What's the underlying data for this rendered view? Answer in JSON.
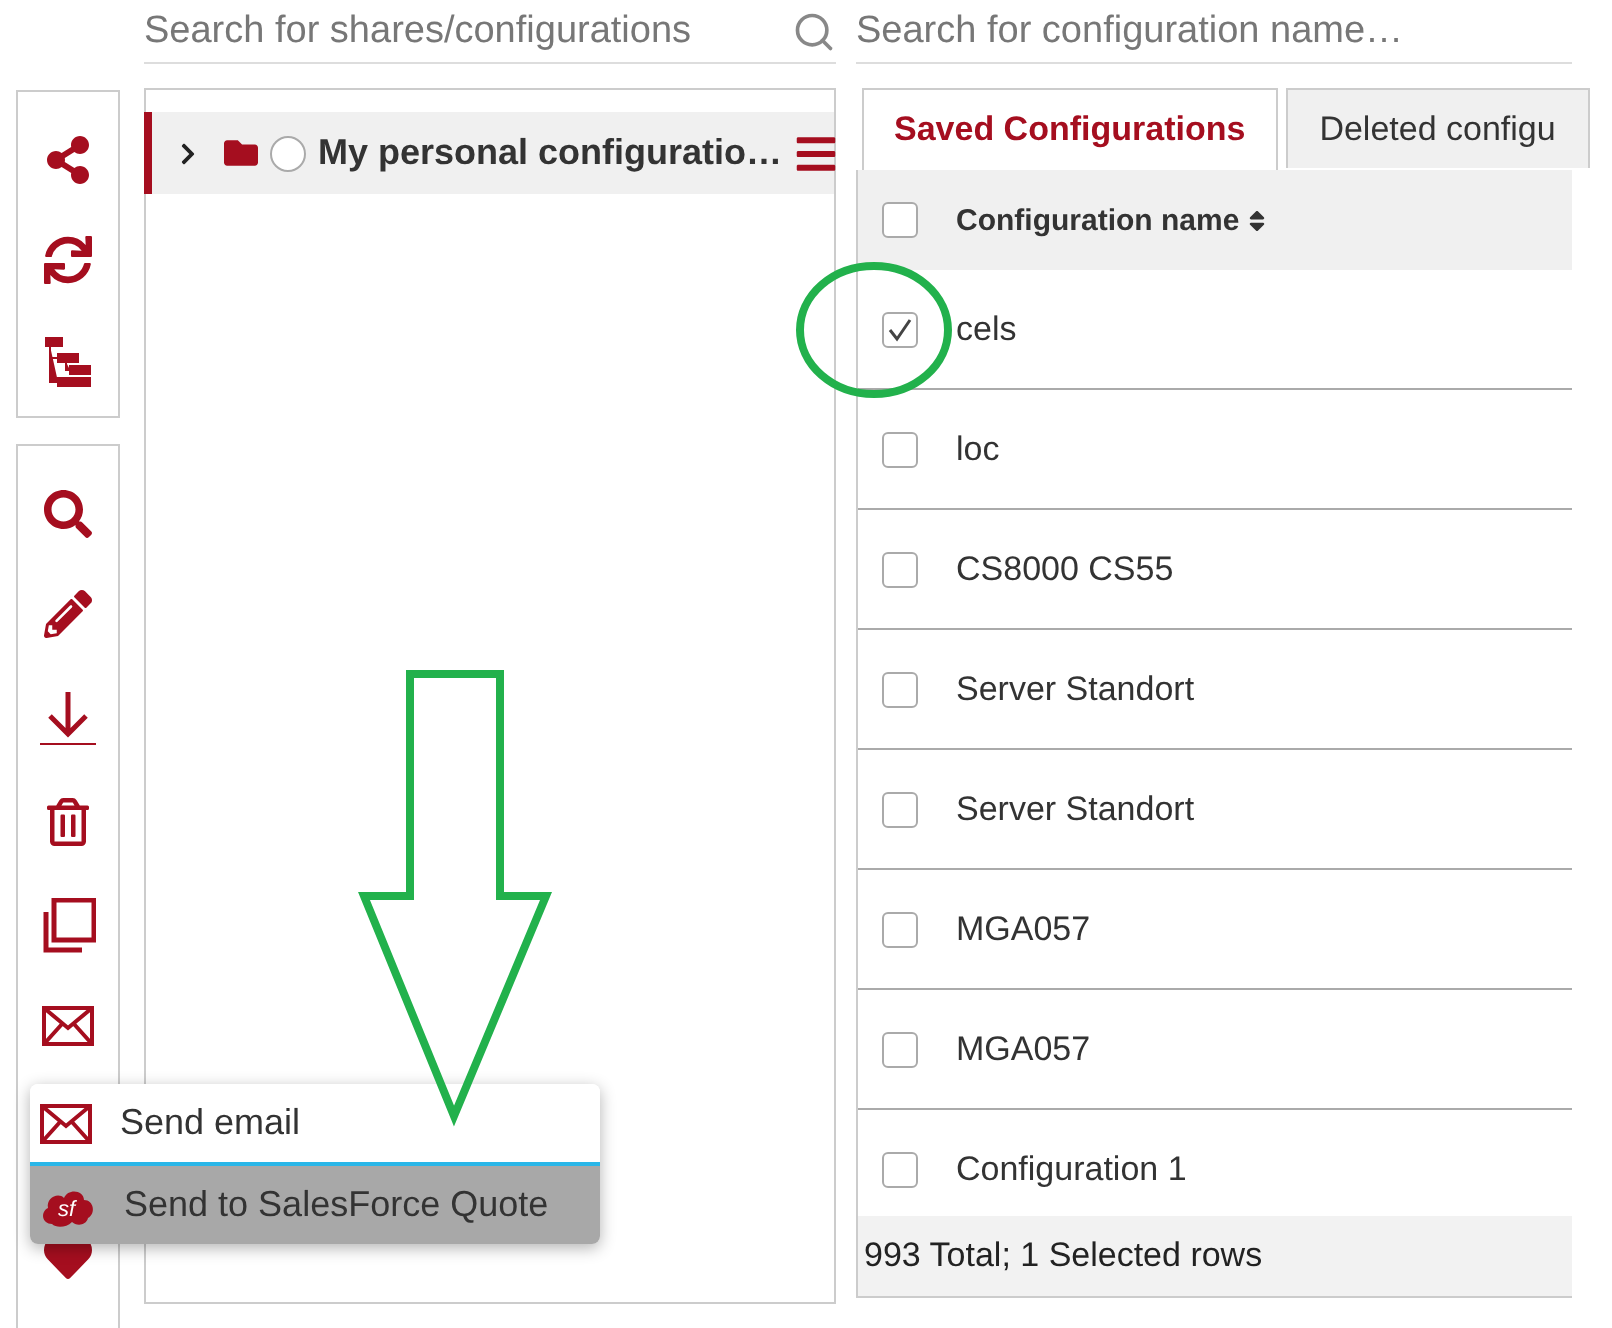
{
  "search_shares": {
    "placeholder": "Search for shares/configurations"
  },
  "search_configs": {
    "placeholder": "Search for configuration name…"
  },
  "tree": {
    "items": [
      {
        "label": "My personal configuratio…",
        "expanded": false,
        "selected": true,
        "checked": false
      }
    ]
  },
  "tabs": [
    {
      "label": "Saved Configurations",
      "selected": true
    },
    {
      "label": "Deleted configu",
      "selected": false
    }
  ],
  "table": {
    "header": {
      "label": "Configuration name",
      "checked": false
    },
    "rows": [
      {
        "name": "cels",
        "checked": true
      },
      {
        "name": "loc",
        "checked": false
      },
      {
        "name": "CS8000 CS55",
        "checked": false
      },
      {
        "name": "Server Standort",
        "checked": false
      },
      {
        "name": "Server Standort",
        "checked": false
      },
      {
        "name": "MGA057",
        "checked": false
      },
      {
        "name": "MGA057",
        "checked": false
      },
      {
        "name": "Configuration 1",
        "checked": false
      }
    ]
  },
  "footer": "993 Total; 1 Selected rows",
  "menu": {
    "items": [
      {
        "kind": "email",
        "label": "Send email",
        "selected": false
      },
      {
        "kind": "salesforce",
        "label": "Send to SalesForce Quote",
        "icon_text": "sf",
        "selected": true
      }
    ]
  }
}
